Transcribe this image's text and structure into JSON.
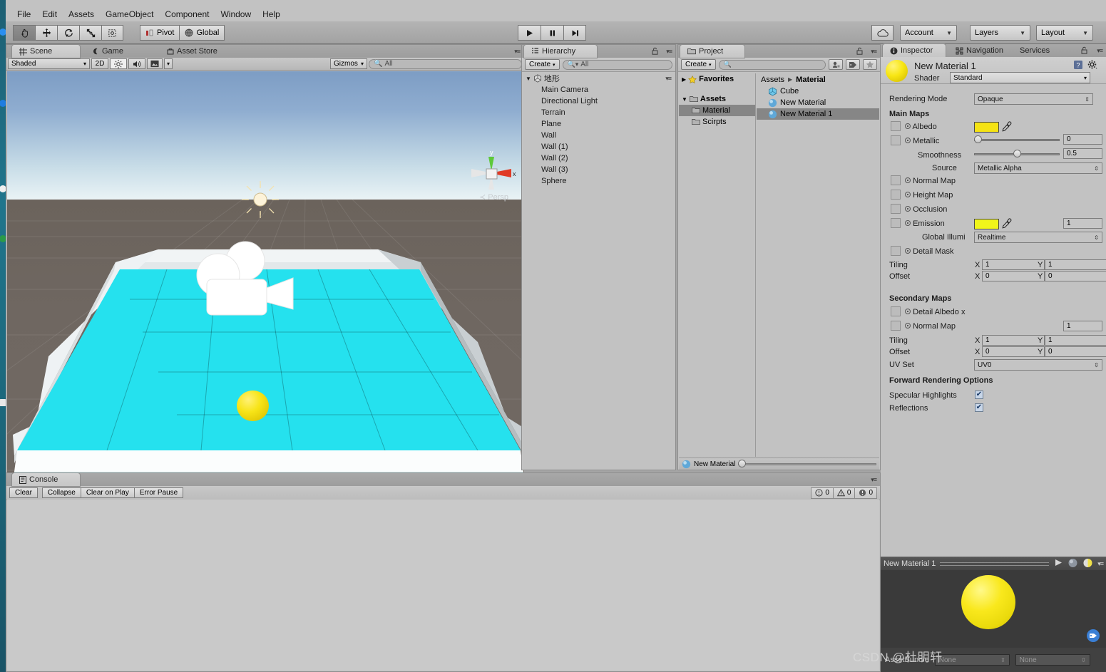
{
  "app": {
    "name": "Unity Editor"
  },
  "menubar": {
    "items": [
      "File",
      "Edit",
      "Assets",
      "GameObject",
      "Component",
      "Window",
      "Help"
    ]
  },
  "toolbar": {
    "tools": [
      {
        "name": "hand-tool",
        "glyph": "✋",
        "active": true
      },
      {
        "name": "move-tool",
        "glyph": "✥",
        "active": false
      },
      {
        "name": "rotate-tool",
        "glyph": "↻",
        "active": false
      },
      {
        "name": "scale-tool",
        "glyph": "⤢",
        "active": false
      },
      {
        "name": "rect-tool",
        "glyph": "⊡",
        "active": false
      }
    ],
    "pivot_label": "Pivot",
    "global_label": "Global",
    "play_label": "▶",
    "pause_label": "❚❚",
    "step_label": "▶❙",
    "cloud_label": "☁",
    "account_label": "Account",
    "layers_label": "Layers",
    "layout_label": "Layout"
  },
  "scene": {
    "tabs": [
      {
        "label": "Scene",
        "icon": "grid-icon",
        "active": true
      },
      {
        "label": "Game",
        "icon": "gamepad-icon",
        "active": false
      },
      {
        "label": "Asset Store",
        "icon": "store-icon",
        "active": false
      }
    ],
    "draw_mode": "Shaded",
    "two_d_label": "2D",
    "lighting_icon": "sun-icon",
    "audio_icon": "speaker-icon",
    "effects_icon": "image-icon",
    "gizmos_label": "Gizmos",
    "search_placeholder": "All",
    "axis_labels": {
      "y": "y",
      "x": "x"
    },
    "projection_label": "Persp",
    "colors": {
      "floor": "#25e1ee",
      "wall": "#e9eef0",
      "sphere": "#f5e313",
      "ground": "#6f6761",
      "sky_top": "#7d9dc4",
      "sky_bottom": "#eef4f6"
    }
  },
  "hierarchy": {
    "tab_label": "Hierarchy",
    "create_label": "Create",
    "search_placeholder": "All",
    "scene_name": "地形",
    "items": [
      {
        "label": "Main Camera"
      },
      {
        "label": "Directional Light"
      },
      {
        "label": "Terrain"
      },
      {
        "label": "Plane"
      },
      {
        "label": "Wall"
      },
      {
        "label": "Wall (1)"
      },
      {
        "label": "Wall (2)"
      },
      {
        "label": "Wall (3)"
      },
      {
        "label": "Sphere"
      }
    ]
  },
  "project": {
    "tab_label": "Project",
    "create_label": "Create",
    "search_placeholder": "",
    "favorites_label": "Favorites",
    "tree": [
      {
        "label": "Assets",
        "depth": 0,
        "expanded": true,
        "selected": false
      },
      {
        "label": "Material",
        "depth": 1,
        "expanded": false,
        "selected": true
      },
      {
        "label": "Scirpts",
        "depth": 1,
        "expanded": false,
        "selected": false
      }
    ],
    "breadcrumb": [
      "Assets",
      "Material"
    ],
    "assets": [
      {
        "label": "Cube",
        "icon": "cube-icon",
        "selected": false
      },
      {
        "label": "New Material",
        "icon": "material-icon",
        "selected": false
      },
      {
        "label": "New Material 1",
        "icon": "material-icon",
        "selected": true
      }
    ],
    "footer_label": "New Material",
    "toolbar_icons": [
      "filter-by-type-icon",
      "filter-by-label-icon",
      "favorite-star-icon"
    ]
  },
  "console": {
    "tab_label": "Console",
    "buttons": [
      "Clear",
      "Collapse",
      "Clear on Play",
      "Error Pause"
    ],
    "counts": [
      {
        "type": "log",
        "icon": "info-icon",
        "value": "0"
      },
      {
        "type": "warning",
        "icon": "warning-icon",
        "value": "0"
      },
      {
        "type": "error",
        "icon": "error-icon",
        "value": "0"
      }
    ]
  },
  "inspector": {
    "tabs": [
      {
        "label": "Inspector",
        "icon": "info-icon",
        "active": true
      },
      {
        "label": "Navigation",
        "icon": "navigation-icon",
        "active": false
      },
      {
        "label": "Services",
        "icon": "services-icon",
        "active": false
      }
    ],
    "material_name": "New Material 1",
    "shader_label": "Shader",
    "shader_value": "Standard",
    "rendering_mode_label": "Rendering Mode",
    "rendering_mode_value": "Opaque",
    "main_maps_header": "Main Maps",
    "albedo_label": "Albedo",
    "albedo_color": "#f5e313",
    "metallic_label": "Metallic",
    "metallic_value": "0",
    "smoothness_label": "Smoothness",
    "smoothness_value": "0.5",
    "source_label": "Source",
    "source_value": "Metallic Alpha",
    "normal_map_label": "Normal Map",
    "height_map_label": "Height Map",
    "occlusion_label": "Occlusion",
    "emission_label": "Emission",
    "emission_color": "#f0f51a",
    "emission_value": "1",
    "global_illum_label": "Global Illumi",
    "global_illum_value": "Realtime",
    "detail_mask_label": "Detail Mask",
    "tiling_label": "Tiling",
    "offset_label": "Offset",
    "x_label": "X",
    "y_label": "Y",
    "tiling_x": "1",
    "tiling_y": "1",
    "offset_x": "0",
    "offset_y": "0",
    "secondary_maps_header": "Secondary Maps",
    "detail_albedo_label": "Detail Albedo x",
    "sec_normal_map_label": "Normal Map",
    "sec_normal_value": "1",
    "sec_tiling_x": "1",
    "sec_tiling_y": "1",
    "sec_offset_x": "0",
    "sec_offset_y": "0",
    "uv_set_label": "UV Set",
    "uv_set_value": "UV0",
    "forward_header": "Forward Rendering Options",
    "specular_label": "Specular Highlights",
    "specular_checked": "✔",
    "reflections_label": "Reflections",
    "reflections_checked": "✔"
  },
  "preview": {
    "title": "New Material 1",
    "play_icon": "play-icon",
    "sphere_icon": "sphere-preview-icon",
    "lighting_icon": "lighting-toggle-icon",
    "assetbundle_label": "AssetBundle",
    "assetbundle_value": "None",
    "assetbundle_variant": "None",
    "sphere_color": "#f7e617"
  },
  "watermark": {
    "text": "CSDN @杜明轩"
  }
}
